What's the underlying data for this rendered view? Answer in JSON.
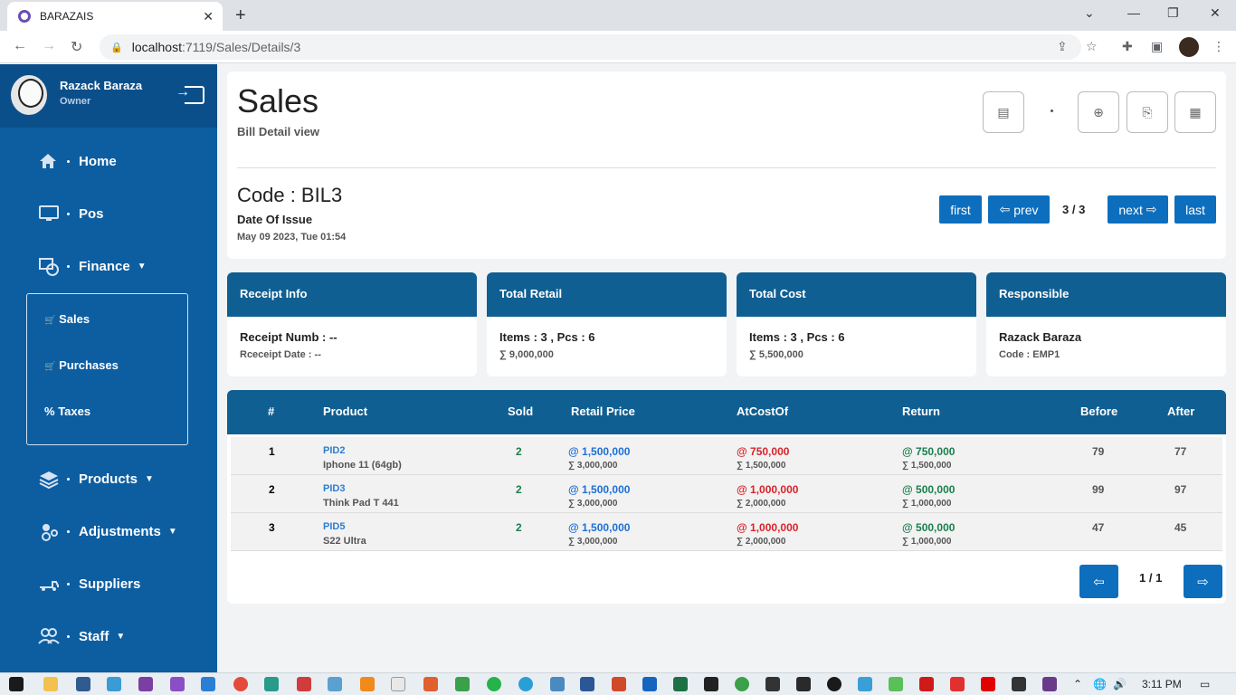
{
  "browser": {
    "tab_title": "BARAZAIS",
    "url_host": "localhost",
    "url_path": ":7119/Sales/Details/3"
  },
  "sidebar": {
    "user_name": "Razack  Baraza",
    "user_role": "Owner",
    "items": [
      {
        "label": "Home",
        "icon": "home-icon"
      },
      {
        "label": "Pos",
        "icon": "monitor-icon"
      },
      {
        "label": "Finance",
        "icon": "finance-icon",
        "caret": "▼"
      },
      {
        "label": "Products",
        "icon": "layers-icon",
        "caret": "▼"
      },
      {
        "label": "Adjustments",
        "icon": "adjustments-icon",
        "caret": "▼"
      },
      {
        "label": "Suppliers",
        "icon": "truck-icon"
      },
      {
        "label": "Staff",
        "icon": "users-icon",
        "caret": "▼"
      }
    ],
    "sub_items": [
      {
        "label": "Sales",
        "prefix": "🛒"
      },
      {
        "label": "Purchases",
        "prefix": "🛒"
      },
      {
        "label": "Taxes",
        "prefix": "%"
      }
    ]
  },
  "header": {
    "title": "Sales",
    "subtitle": "Bill Detail view",
    "code": "Code : BIL3",
    "date_label": "Date Of Issue",
    "date_value": "May 09 2023, Tue 01:54",
    "first": "first",
    "prev": "prev",
    "count": "3 / 3",
    "next": "next",
    "last": "last"
  },
  "cards": [
    {
      "head": "Receipt Info",
      "main": "Receipt Numb : --",
      "sub": "Rceceipt Date : --"
    },
    {
      "head": "Total Retail",
      "main": "Items : 3 , Pcs : 6",
      "sub": "∑ 9,000,000"
    },
    {
      "head": "Total Cost",
      "main": "Items : 3 , Pcs : 6",
      "sub": "∑ 5,500,000"
    },
    {
      "head": "Responsible",
      "main": "Razack Baraza",
      "sub": "Code : EMP1"
    }
  ],
  "table": {
    "columns": [
      "#",
      "Product",
      "Sold",
      "Retail Price",
      "AtCostOf",
      "Return",
      "Before",
      "After"
    ],
    "rows": [
      {
        "n": "1",
        "pid": "PID2",
        "name": "Iphone 11 (64gb)",
        "sold": "2",
        "retail": "@ 1,500,000",
        "retail_sum": "∑ 3,000,000",
        "cost": "@ 750,000",
        "cost_sum": "∑ 1,500,000",
        "ret": "@ 750,000",
        "ret_sum": "∑ 1,500,000",
        "before": "79",
        "after": "77"
      },
      {
        "n": "2",
        "pid": "PID3",
        "name": "Think Pad T 441",
        "sold": "2",
        "retail": "@ 1,500,000",
        "retail_sum": "∑ 3,000,000",
        "cost": "@ 1,000,000",
        "cost_sum": "∑ 2,000,000",
        "ret": "@ 500,000",
        "ret_sum": "∑ 1,000,000",
        "before": "99",
        "after": "97"
      },
      {
        "n": "3",
        "pid": "PID5",
        "name": "S22 Ultra",
        "sold": "2",
        "retail": "@ 1,500,000",
        "retail_sum": "∑ 3,000,000",
        "cost": "@ 1,000,000",
        "cost_sum": "∑ 2,000,000",
        "ret": "@ 500,000",
        "ret_sum": "∑ 1,000,000",
        "before": "47",
        "after": "45"
      }
    ],
    "page": "1 / 1"
  },
  "taskbar": {
    "time": "3:11 PM"
  }
}
